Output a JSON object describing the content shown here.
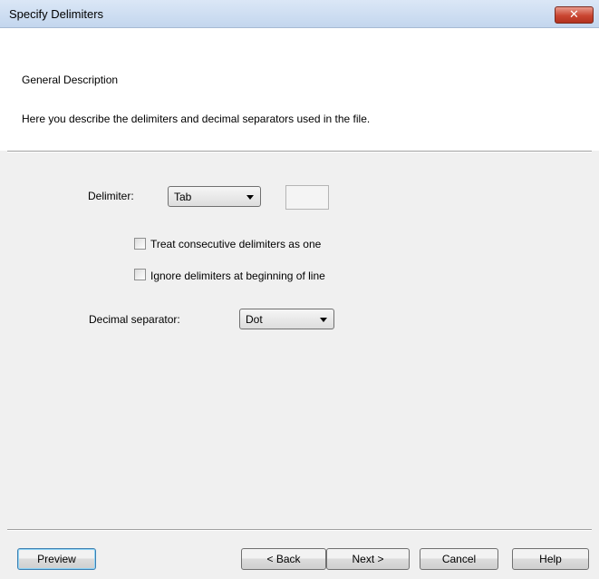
{
  "window": {
    "title": "Specify Delimiters",
    "close_glyph": "✕"
  },
  "header": {
    "heading": "General Description",
    "description": "Here you describe the delimiters and decimal separators used in the file."
  },
  "form": {
    "delimiter_label": "Delimiter:",
    "delimiter_value": "Tab",
    "custom_delimiter_value": "",
    "consecutive_label": "Treat consecutive delimiters as one",
    "consecutive_checked": false,
    "ignore_label": "Ignore delimiters at beginning of line",
    "ignore_checked": false,
    "decimal_label": "Decimal separator:",
    "decimal_value": "Dot"
  },
  "buttons": {
    "preview": "Preview",
    "back": "< Back",
    "next": "Next >",
    "cancel": "Cancel",
    "help": "Help"
  }
}
